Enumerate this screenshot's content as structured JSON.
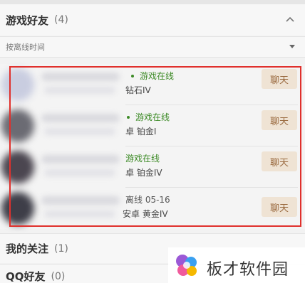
{
  "sections": {
    "game_friends": {
      "title": "游戏好友",
      "count": "(4)"
    },
    "following": {
      "title": "我的关注",
      "count": "(1)"
    },
    "qq_friends": {
      "title": "QQ好友",
      "count": "(0)"
    }
  },
  "sort": {
    "label": "按离线时间"
  },
  "friends": [
    {
      "status": "游戏在线",
      "online": true,
      "device": "钻石IV",
      "chat_label": "聊天"
    },
    {
      "status": "游戏在线",
      "online": true,
      "device": "卓 铂金I",
      "chat_label": "聊天"
    },
    {
      "status": "游戏在线",
      "online": true,
      "device": "卓 铂金IV",
      "chat_label": "聊天"
    },
    {
      "status": "离线 05-16",
      "online": false,
      "device": "安卓 黄金IV",
      "chat_label": "聊天"
    }
  ],
  "watermark": {
    "text": "板才软件园"
  },
  "colors": {
    "online": "#3c8a26",
    "chat_bg": "#efe3d4",
    "chat_text": "#9a6a3f",
    "highlight": "#e0302c"
  }
}
